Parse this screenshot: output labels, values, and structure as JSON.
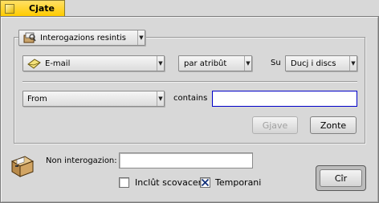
{
  "window": {
    "title": "Cjate"
  },
  "query_type": {
    "label": "Interogazions resintis"
  },
  "file_type": {
    "label": "E-mail"
  },
  "search_mode": {
    "label": "par atribût"
  },
  "volume": {
    "prefix": "Su",
    "label": "Ducj i discs"
  },
  "attribute": {
    "label": "From"
  },
  "operator": {
    "label": "contains"
  },
  "value_input": {
    "value": ""
  },
  "buttons": {
    "remove": "Gjave",
    "add": "Zonte",
    "search": "Cîr"
  },
  "query_name": {
    "label": "Non interogazion:",
    "value": ""
  },
  "options": [
    {
      "label": "Inclût scovacere",
      "checked": false
    },
    {
      "label": "Temporani",
      "checked": true
    }
  ],
  "icons": {
    "close": "close-box-icon",
    "query": "query-folder-icon",
    "mail": "envelope-icon",
    "drawer": "file-drawer-icon"
  }
}
